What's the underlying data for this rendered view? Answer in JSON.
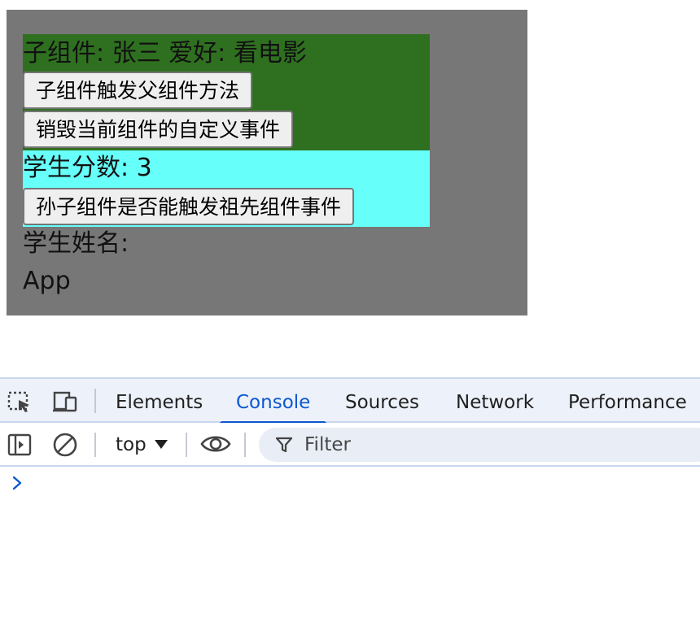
{
  "page": {
    "child": {
      "info": "子组件: 张三  爱好: 看电影",
      "trigger_parent_button": "子组件触发父组件方法",
      "destroy_events_button": "销毁当前组件的自定义事件"
    },
    "grandchild": {
      "score": "学生分数: 3",
      "trigger_ancestor_button": "孙子组件是否能触发祖先组件事件"
    },
    "student_name": "学生姓名:",
    "app_label": "App"
  },
  "devtools": {
    "tabs": [
      {
        "label": "Elements",
        "active": false
      },
      {
        "label": "Console",
        "active": true
      },
      {
        "label": "Sources",
        "active": false
      },
      {
        "label": "Network",
        "active": false
      },
      {
        "label": "Performance",
        "active": false
      }
    ],
    "toolbar": {
      "context": "top",
      "filter_placeholder": "Filter"
    },
    "icons": {
      "inspect": "inspect-element-icon",
      "device": "device-toolbar-icon",
      "sidebar": "console-sidebar-icon",
      "clear": "clear-console-icon",
      "eye": "live-expression-icon",
      "filter": "filter-icon",
      "prompt": "console-prompt-icon"
    },
    "colors": {
      "accent": "#0b57d0",
      "app_bg": "#777777",
      "child_bg": "#2f7020",
      "grandchild_bg": "#66fffa"
    }
  }
}
